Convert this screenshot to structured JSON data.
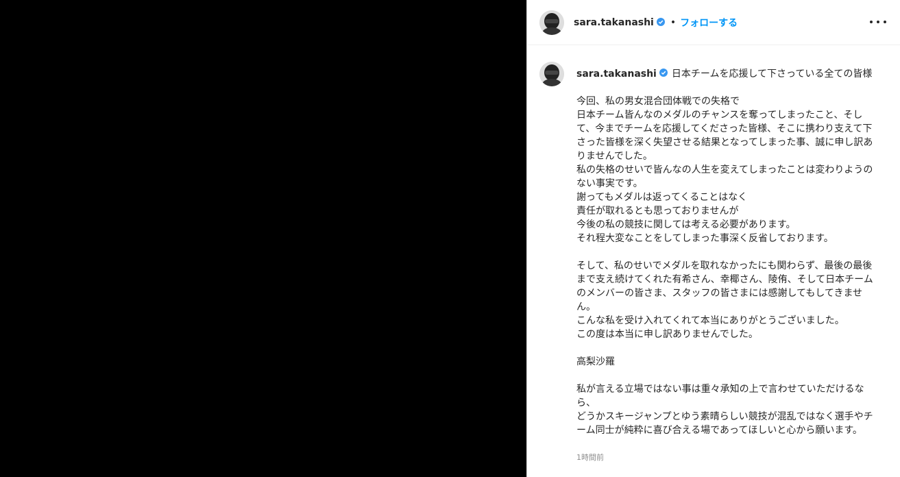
{
  "post": {
    "username": "sara.takanashi",
    "follow_label": "フォローする",
    "dot": "•",
    "caption_first_line": "日本チームを応援して下さっている全ての皆様",
    "caption_body": "今回、私の男女混合団体戦での失格で\n日本チーム皆んなのメダルのチャンスを奪ってしまったこと、そして、今までチームを応援してくださった皆様、そこに携わり支えて下さった皆様を深く失望させる結果となってしまった事、誠に申し訳ありませんでした。\n私の失格のせいで皆んなの人生を変えてしまったことは変わりようのない事実です。\n謝ってもメダルは返ってくることはなく\n責任が取れるとも思っておりませんが\n今後の私の競技に関しては考える必要があります。\nそれ程大変なことをしてしまった事深く反省しております。\n\nそして、私のせいでメダルを取れなかったにも関わらず、最後の最後まで支え続けてくれた有希さん、幸椰さん、陵侑、そして日本チームのメンバーの皆さま、スタッフの皆さまには感謝してもしてきません。\nこんな私を受け入れてくれて本当にありがとうございました。\nこの度は本当に申し訳ありませんでした。\n\n高梨沙羅\n\n私が言える立場ではない事は重々承知の上で言わせていただけるなら、\nどうかスキージャンプとゆう素晴らしい競技が混乱ではなく選手やチーム同士が純粋に喜び合える場であってほしいと心から願います。",
    "timestamp": "1時間前"
  },
  "icons": {
    "verified": "verified-badge-icon",
    "more": "more-options-icon",
    "avatar": "profile-avatar"
  },
  "colors": {
    "link_blue": "#0095f6",
    "text": "#262626",
    "muted": "#8e8e8e"
  }
}
